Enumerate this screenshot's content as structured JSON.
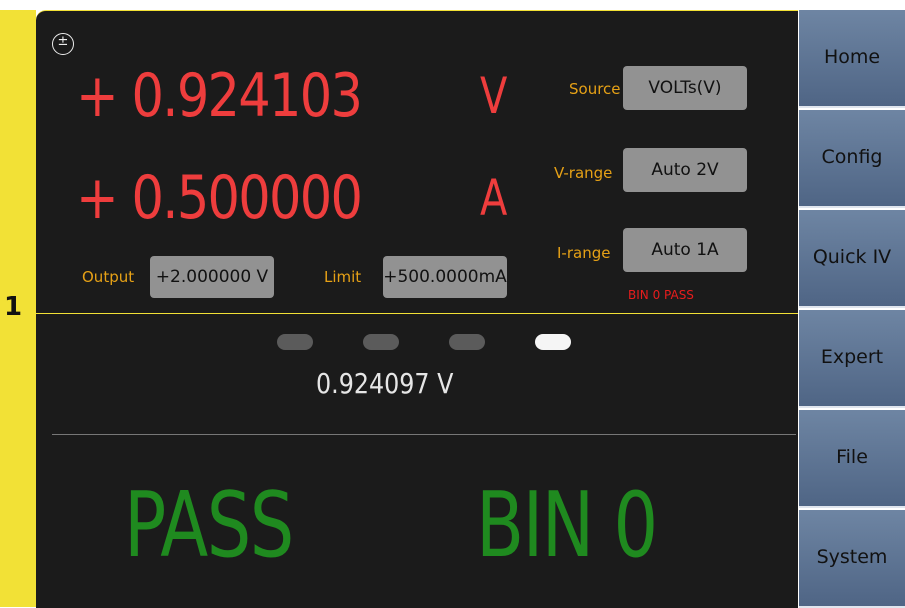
{
  "channel": "1",
  "measurement": {
    "voltage_sign": "+",
    "voltage_value": "0.924103",
    "voltage_unit": "V",
    "current_sign": "+",
    "current_value": "0.500000",
    "current_unit": "A"
  },
  "settings": {
    "source_label": "Source",
    "source_value": "VOLTs(V)",
    "vrange_label": "V-range",
    "vrange_value": "Auto 2V",
    "irange_label": "I-range",
    "irange_value": "Auto 1A",
    "output_label": "Output",
    "output_value": "+2.000000 V",
    "limit_label": "Limit",
    "limit_value": "+500.0000mA",
    "bin_status": "BIN 0 PASS"
  },
  "indicators": [
    {
      "state": "off"
    },
    {
      "state": "off"
    },
    {
      "state": "off"
    },
    {
      "state": "on"
    }
  ],
  "secondary_reading": "0.924097 V",
  "result": {
    "pass_text": "PASS",
    "bin_text": "BIN 0"
  },
  "sidebar": {
    "items": [
      {
        "label": "Home"
      },
      {
        "label": "Config"
      },
      {
        "label": "Quick IV"
      },
      {
        "label": "Expert"
      },
      {
        "label": "File"
      },
      {
        "label": "System"
      }
    ]
  },
  "colors": {
    "background": "#1b1b1b",
    "reading": "#ee3d3d",
    "label": "#e6a116",
    "pass": "#1f8a1f",
    "channel_bar": "#f2e136",
    "sidebar_button": "#5f7696"
  }
}
